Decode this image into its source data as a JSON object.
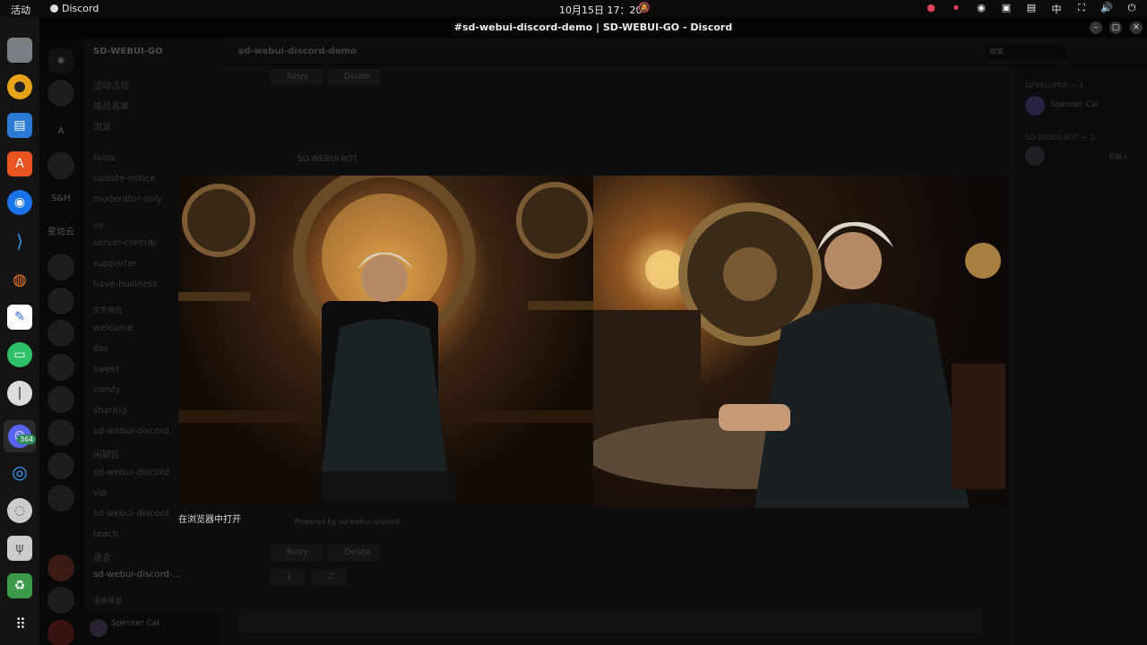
{
  "topbar": {
    "activities": "活动",
    "app_name": "Discord",
    "clock": "10月15日  17：20",
    "input_method": "中"
  },
  "dock": {
    "items": [
      "files-icon",
      "music-icon",
      "writer-icon",
      "app-store-icon",
      "chrome-icon",
      "vscode-icon",
      "blender-icon",
      "text-editor-icon",
      "wechat-icon",
      "password-icon",
      "discord-icon",
      "spiral-app-icon",
      "disk-icon",
      "usb-icon",
      "trash-icon",
      "app-grid-icon"
    ],
    "discord_badge": "364"
  },
  "window": {
    "title": "#sd-webui-discord-demo | SD-WEBUI-GO - Discord"
  },
  "discord": {
    "server_name": "SD-WEBUI-GO",
    "guild_labels": [
      "A",
      "S&H",
      "星坊云"
    ],
    "channels": {
      "top": [
        "活动活动",
        "成员名单",
        "浏览"
      ],
      "list1": [
        "rules",
        "update-notice",
        "moderator-only"
      ],
      "cat_vip": "vip",
      "list2": [
        "server-contrib",
        "supporter",
        "have-business"
      ],
      "cat_text": "文字频道",
      "list3": [
        "welcome",
        "dss",
        "sweet",
        "comfy",
        "sharing",
        "sd-webui-discord",
        "闲聊区",
        "sd-webui-discord",
        "vip",
        "sd-webui-discord",
        "teach",
        "语言",
        "sd-webui-discord-..."
      ],
      "bottom_cat": "语音频道"
    },
    "user": {
      "name": "Spenser Cai"
    },
    "header": {
      "channel": "sd-webui-discord-demo",
      "search_placeholder": "搜索"
    },
    "buttons": {
      "retry": "Retry",
      "delete": "Delete"
    },
    "bot": "SD-WEBUI-BOT",
    "powered_by": "Powered by sd-webui-discord",
    "reactions": [
      "1",
      "2"
    ],
    "members": {
      "cat_developer": "DEVELOPER — 1",
      "developer": "Spenser Cai",
      "cat_bot": "SD-WEBUI-BOT — 1",
      "bot_tag": "机器人"
    }
  },
  "viewer": {
    "open_in_browser": "在浏览器中打开"
  }
}
